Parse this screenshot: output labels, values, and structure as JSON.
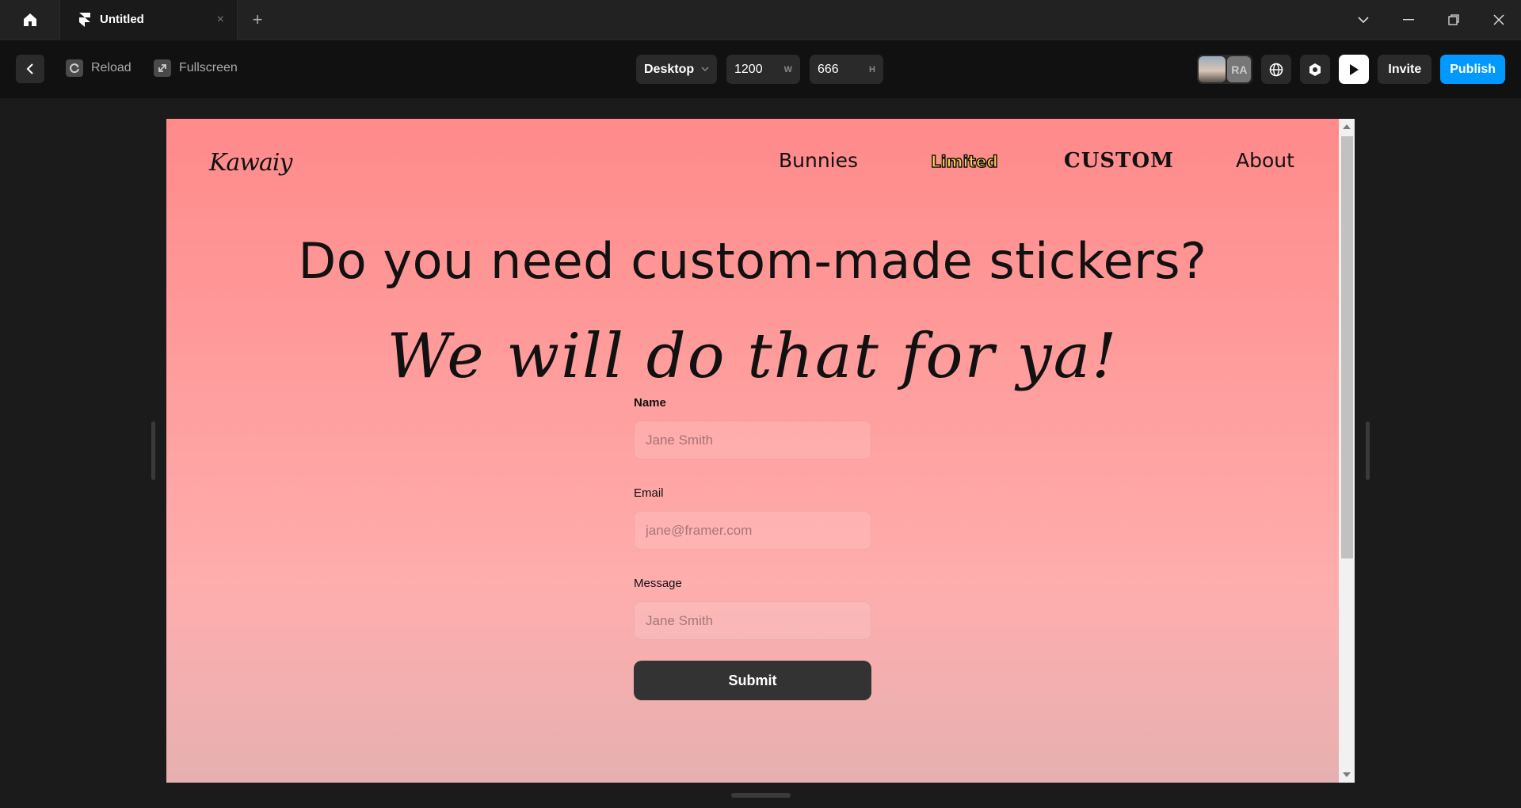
{
  "window": {
    "tab_title": "Untitled",
    "tab_close": "×",
    "new_tab": "+",
    "controls": {
      "dropdown": "⌄",
      "minimize": "—",
      "restore": "❐",
      "close": "✕"
    }
  },
  "toolbar": {
    "reload_label": "Reload",
    "fullscreen_label": "Fullscreen",
    "device": "Desktop",
    "width_value": "1200",
    "width_suffix": "W",
    "height_value": "666",
    "height_suffix": "H",
    "avatar_initials": "RA",
    "invite_label": "Invite",
    "publish_label": "Publish",
    "colors": {
      "publish": "#0099ff"
    }
  },
  "site": {
    "logo": "Kawaiy",
    "nav": [
      "Bunnies",
      "Limited",
      "CUSTOM",
      "About"
    ],
    "headline": "Do you need custom-made stickers?",
    "tagline": "We will do that for ya!",
    "form": {
      "name_label": "Name",
      "name_placeholder": "Jane Smith",
      "email_label": "Email",
      "email_placeholder": "jane@framer.com",
      "message_label": "Message",
      "message_placeholder": "Jane Smith",
      "submit_label": "Submit"
    }
  }
}
